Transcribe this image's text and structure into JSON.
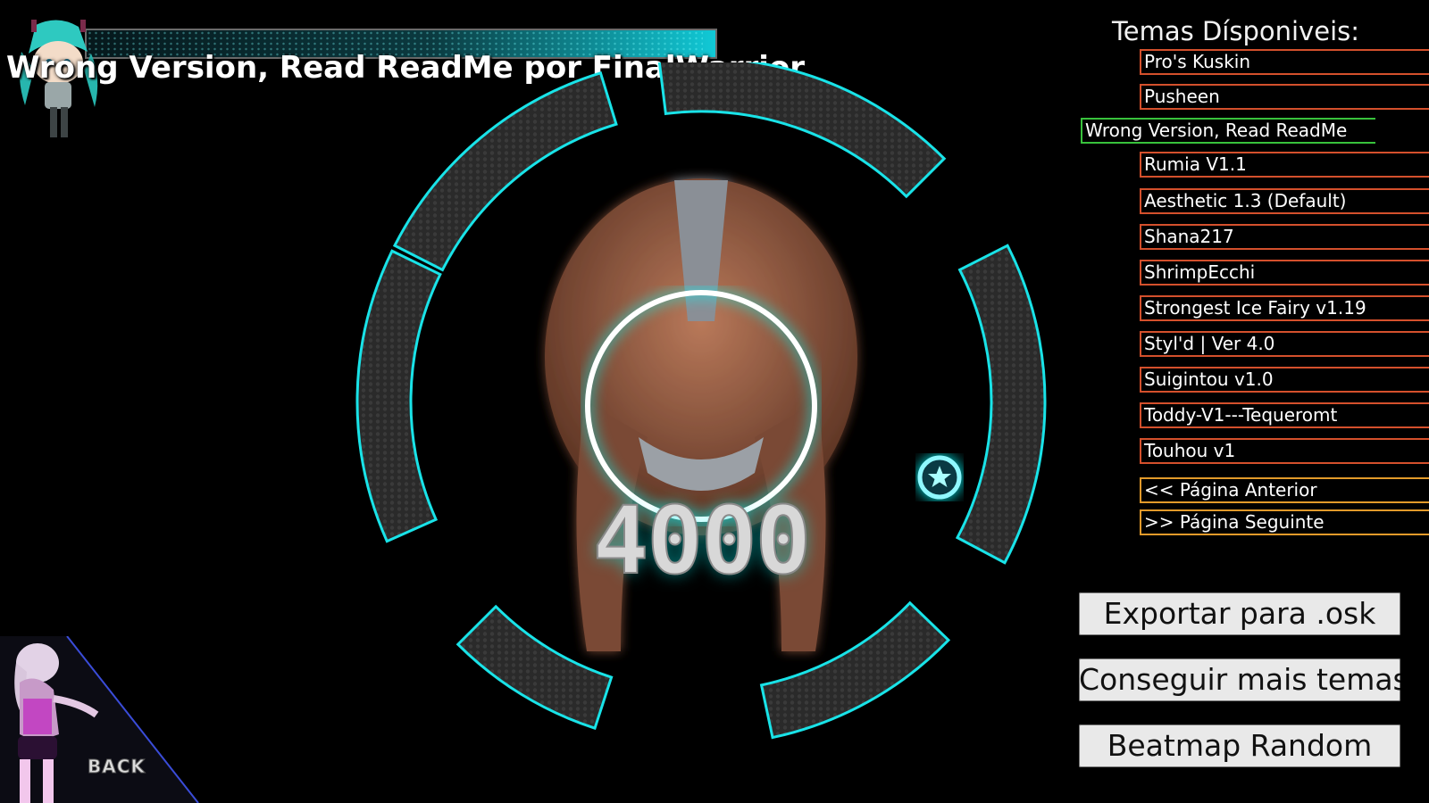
{
  "header": {
    "title": "Wrong Version, Read ReadMe por FinalWarrior",
    "health_fraction": 0.98
  },
  "score": "4000",
  "theme_list": {
    "heading": "Temas Dísponiveis:",
    "items": [
      {
        "label": "Pro's Kuskin",
        "state": "normal"
      },
      {
        "label": "Pusheen",
        "state": "normal"
      },
      {
        "label": "Wrong Version, Read ReadMe",
        "state": "selected"
      },
      {
        "label": "Rumia V1.1",
        "state": "normal"
      },
      {
        "label": "Aesthetic 1.3 (Default)",
        "state": "normal"
      },
      {
        "label": "Shana217",
        "state": "normal"
      },
      {
        "label": "ShrimpEcchi",
        "state": "normal"
      },
      {
        "label": "Strongest Ice Fairy v1.19",
        "state": "normal"
      },
      {
        "label": "Styl'd | Ver 4.0",
        "state": "normal"
      },
      {
        "label": "Suigintou v1.0",
        "state": "normal"
      },
      {
        "label": "Toddy-V1---Tequeromt",
        "state": "normal"
      },
      {
        "label": "Touhou v1",
        "state": "normal"
      }
    ],
    "prev_page": "<< Página Anterior",
    "next_page": ">> Página Seguinte"
  },
  "actions": {
    "export": "Exportar para .osk",
    "get_more": "Conseguir mais temas",
    "random_beatmap": "Beatmap Random"
  },
  "back": {
    "label": "BACK"
  },
  "icons": {
    "cursor": "star-cursor-icon",
    "hit_circle": "approach-circle-icon",
    "mascot": "mascot-character-icon"
  },
  "colors": {
    "accent_cyan": "#19e3e8",
    "item_border": "#d4502c",
    "selected_border": "#38c23c",
    "nav_border": "#e29a2a"
  }
}
